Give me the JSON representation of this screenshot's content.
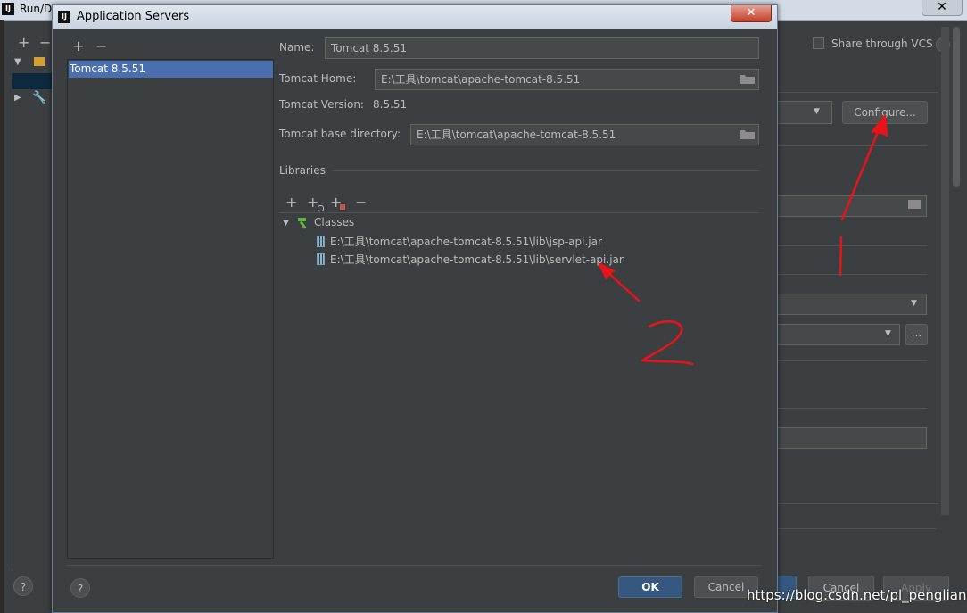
{
  "background": {
    "window_title": "Run/D",
    "share_label": "Share through VCS",
    "configure_label": "Configure...",
    "cancel_label": "Cancel",
    "apply_label": "Apply"
  },
  "dialog": {
    "title": "Application Servers",
    "close_glyph": "✕",
    "list_toolbar": {
      "add": "+",
      "remove": "−"
    },
    "servers": [
      "Tomcat 8.5.51"
    ],
    "name_label": "Name:",
    "name_value": "Tomcat 8.5.51",
    "home_label": "Tomcat Home:",
    "home_value": "E:\\工具\\tomcat\\apache-tomcat-8.5.51",
    "version_label": "Tomcat Version:",
    "version_value": "8.5.51",
    "base_label": "Tomcat base directory:",
    "base_value": "E:\\工具\\tomcat\\apache-tomcat-8.5.51",
    "libraries_label": "Libraries",
    "lib_toolbar": {
      "add": "+",
      "add_ext": "+",
      "add_attach": "+",
      "remove": "−"
    },
    "classes_label": "Classes",
    "jars": [
      "E:\\工具\\tomcat\\apache-tomcat-8.5.51\\lib\\jsp-api.jar",
      "E:\\工具\\tomcat\\apache-tomcat-8.5.51\\lib\\servlet-api.jar"
    ],
    "ok_label": "OK",
    "cancel_label": "Cancel",
    "help_glyph": "?"
  },
  "annotations": {
    "arrow1_label": "1",
    "arrow2_label": "2",
    "color": "#e8141a"
  },
  "watermark": "https://blog.csdn.net/pl_pengliang"
}
